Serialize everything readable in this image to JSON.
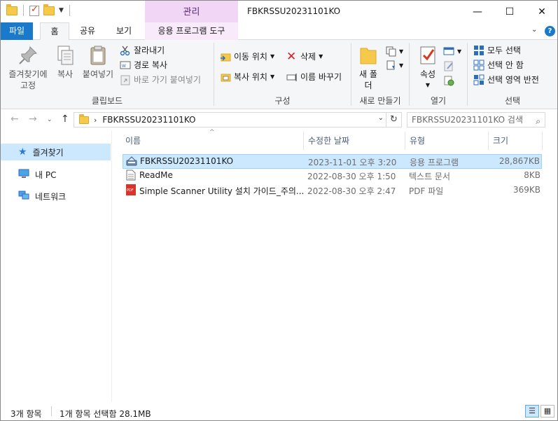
{
  "window": {
    "title": "FBKRSSU20231101KO",
    "context_tab": "관리"
  },
  "window_controls": {
    "minimize": "—",
    "maximize": "☐",
    "close": "✕"
  },
  "tabs": {
    "file": "파일",
    "home": "홈",
    "share": "공유",
    "view": "보기",
    "app_tools": "응용 프로그램 도구"
  },
  "ribbon": {
    "clipboard": {
      "pin": "즐겨찾기에 고정",
      "copy": "복사",
      "paste": "붙여넣기",
      "cut": "잘라내기",
      "copy_path": "경로 복사",
      "paste_shortcut": "바로 가기 붙여넣기",
      "label": "클립보드"
    },
    "organize": {
      "move_to": "이동 위치",
      "copy_to": "복사 위치",
      "delete": "삭제",
      "rename": "이름 바꾸기",
      "label": "구성"
    },
    "new": {
      "new_folder": "새 폴더",
      "label": "새로 만들기"
    },
    "open": {
      "properties": "속성",
      "label": "열기"
    },
    "select": {
      "select_all": "모두 선택",
      "select_none": "선택 안 함",
      "invert": "선택 영역 반전",
      "label": "선택"
    }
  },
  "address": {
    "path": "FBKRSSU20231101KO",
    "search_placeholder": "FBKRSSU20231101KO 검색"
  },
  "nav_pane": {
    "quick_access": "즐겨찾기",
    "this_pc": "내 PC",
    "network": "네트워크"
  },
  "columns": {
    "name": "이름",
    "modified": "수정한 날짜",
    "type": "유형",
    "size": "크기"
  },
  "files": [
    {
      "name": "FBKRSSU20231101KO",
      "modified": "2023-11-01 오후 3:20",
      "type": "응용 프로그램",
      "size": "28,867KB"
    },
    {
      "name": "ReadMe",
      "modified": "2022-08-30 오후 1:50",
      "type": "텍스트 문서",
      "size": "8KB"
    },
    {
      "name": "Simple Scanner Utility 설치 가이드_주의...",
      "modified": "2022-08-30 오후 2:47",
      "type": "PDF 파일",
      "size": "369KB"
    }
  ],
  "status": {
    "count": "3개 항목",
    "selection": "1개 항목 선택함 28.1MB"
  },
  "colors": {
    "accent": "#1979ca",
    "selection": "#cce8ff",
    "context_tab": "#f1d7f5"
  }
}
